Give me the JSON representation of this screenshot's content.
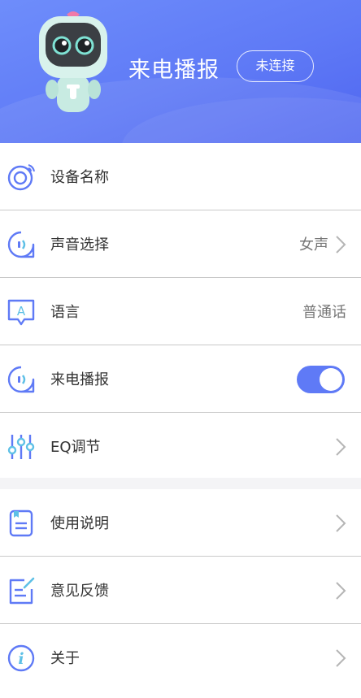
{
  "header": {
    "title": "来电播报",
    "status": "未连接"
  },
  "colors": {
    "accent": "#5f7af6",
    "header_gradient_start": "#6e8dfb",
    "header_gradient_end": "#4f66f0",
    "toggle_on": "#5f7af6"
  },
  "settings": {
    "device_name": {
      "label": "设备名称",
      "icon": "ring-target-icon"
    },
    "voice": {
      "label": "声音选择",
      "value": "女声",
      "icon": "sound-bubble-icon"
    },
    "language": {
      "label": "语言",
      "value": "普通话",
      "icon": "language-a-icon"
    },
    "call_broadcast": {
      "label": "来电播报",
      "enabled": true,
      "icon": "sound-bubble-icon"
    },
    "eq": {
      "label": "EQ调节",
      "icon": "sliders-icon"
    }
  },
  "info": {
    "manual": {
      "label": "使用说明",
      "icon": "document-icon"
    },
    "feedback": {
      "label": "意见反馈",
      "icon": "edit-note-icon"
    },
    "about": {
      "label": "关于",
      "icon": "info-circle-icon"
    }
  }
}
